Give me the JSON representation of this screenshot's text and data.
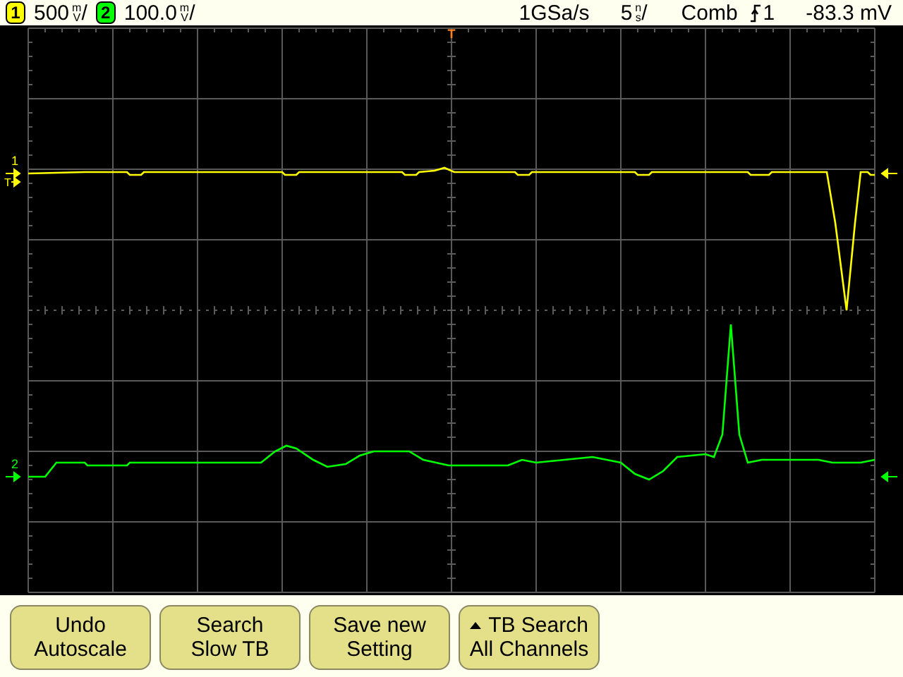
{
  "status_bar": {
    "channels": [
      {
        "number": "1",
        "scale": "500",
        "unit_top": "m",
        "unit_bottom": "V",
        "per": "/",
        "color": "#ffff00"
      },
      {
        "number": "2",
        "scale": "100.0",
        "unit_top": "m",
        "unit_bottom": "V",
        "per": "/",
        "color": "#00ff00"
      }
    ],
    "sample_rate": "1GSa/s",
    "timebase": {
      "value": "5",
      "unit_top": "n",
      "unit_bottom": "s",
      "per": "/"
    },
    "trigger": {
      "mode": "Comb",
      "source": "1",
      "level": "-83.3 mV"
    }
  },
  "screen": {
    "trigger_marker": "T",
    "traces": [
      {
        "marker_label": "1",
        "trigger_label": "T",
        "color": "#ffff00"
      },
      {
        "marker_label": "2",
        "color": "#00ff00"
      }
    ]
  },
  "softkeys": [
    {
      "line1": "Undo",
      "line2": "Autoscale",
      "kind": "plain"
    },
    {
      "line1": "Search",
      "line2": "Slow TB",
      "kind": "plain"
    },
    {
      "line1": "Save new",
      "line2": "Setting",
      "kind": "plain"
    },
    {
      "line1": "TB Search",
      "line2": "All Channels",
      "kind": "toggle"
    }
  ]
}
